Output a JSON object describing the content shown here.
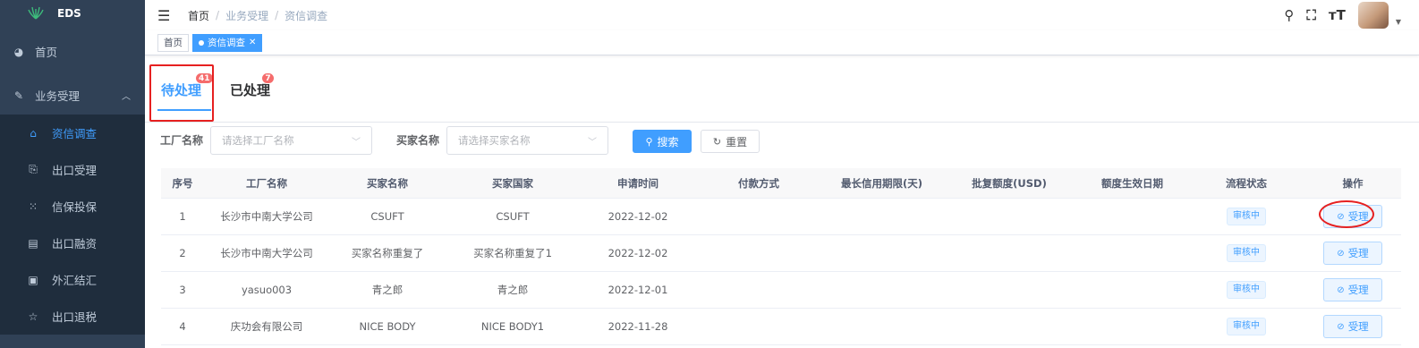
{
  "app": {
    "logo_text": "EDS"
  },
  "sidebar": {
    "items": [
      {
        "label": "首页",
        "icon": "dashboard-icon"
      },
      {
        "label": "业务受理",
        "icon": "edit-doc-icon",
        "expanded": true
      }
    ],
    "subitems": [
      {
        "label": "资信调查",
        "icon": "lock-icon",
        "active": true
      },
      {
        "label": "出口受理",
        "icon": "exit-icon"
      },
      {
        "label": "信保投保",
        "icon": "grid-icon"
      },
      {
        "label": "出口融资",
        "icon": "finance-icon"
      },
      {
        "label": "外汇结汇",
        "icon": "exchange-icon"
      },
      {
        "label": "出口退税",
        "icon": "star-icon"
      }
    ]
  },
  "header": {
    "breadcrumb": [
      "首页",
      "业务受理",
      "资信调查"
    ]
  },
  "tags": [
    {
      "label": "首页",
      "active": false
    },
    {
      "label": "资信调查",
      "active": true
    }
  ],
  "status_tabs": [
    {
      "label": "待处理",
      "badge": "41",
      "active": true
    },
    {
      "label": "已处理",
      "badge": "7",
      "active": false
    }
  ],
  "filters": {
    "factory_label": "工厂名称",
    "factory_placeholder": "请选择工厂名称",
    "buyer_label": "买家名称",
    "buyer_placeholder": "请选择买家名称",
    "search_label": "搜索",
    "reset_label": "重置"
  },
  "table": {
    "columns": [
      "序号",
      "工厂名称",
      "买家名称",
      "买家国家",
      "申请时间",
      "付款方式",
      "最长信用期限(天)",
      "批复额度(USD)",
      "额度生效日期",
      "流程状态",
      "操作"
    ],
    "rows": [
      {
        "no": "1",
        "factory": "长沙市中南大学公司",
        "buyer": "CSUFT",
        "country": "CSUFT",
        "date": "2022-12-02",
        "payment": "",
        "credit_days": "",
        "amount": "",
        "effective": "",
        "status": "审核中",
        "action": "受理"
      },
      {
        "no": "2",
        "factory": "长沙市中南大学公司",
        "buyer": "买家名称重复了",
        "country": "买家名称重复了1",
        "date": "2022-12-02",
        "payment": "",
        "credit_days": "",
        "amount": "",
        "effective": "",
        "status": "审核中",
        "action": "受理"
      },
      {
        "no": "3",
        "factory": "yasuo003",
        "buyer": "青之郎",
        "country": "青之郎",
        "date": "2022-12-01",
        "payment": "",
        "credit_days": "",
        "amount": "",
        "effective": "",
        "status": "审核中",
        "action": "受理"
      },
      {
        "no": "4",
        "factory": "庆功会有限公司",
        "buyer": "NICE BODY",
        "country": "NICE BODY1",
        "date": "2022-11-28",
        "payment": "",
        "credit_days": "",
        "amount": "",
        "effective": "",
        "status": "审核中",
        "action": "受理"
      }
    ]
  },
  "colors": {
    "accent": "#409eff",
    "sidebar_bg": "#304156",
    "annotation": "#e62020",
    "badge": "#f56c6c"
  }
}
